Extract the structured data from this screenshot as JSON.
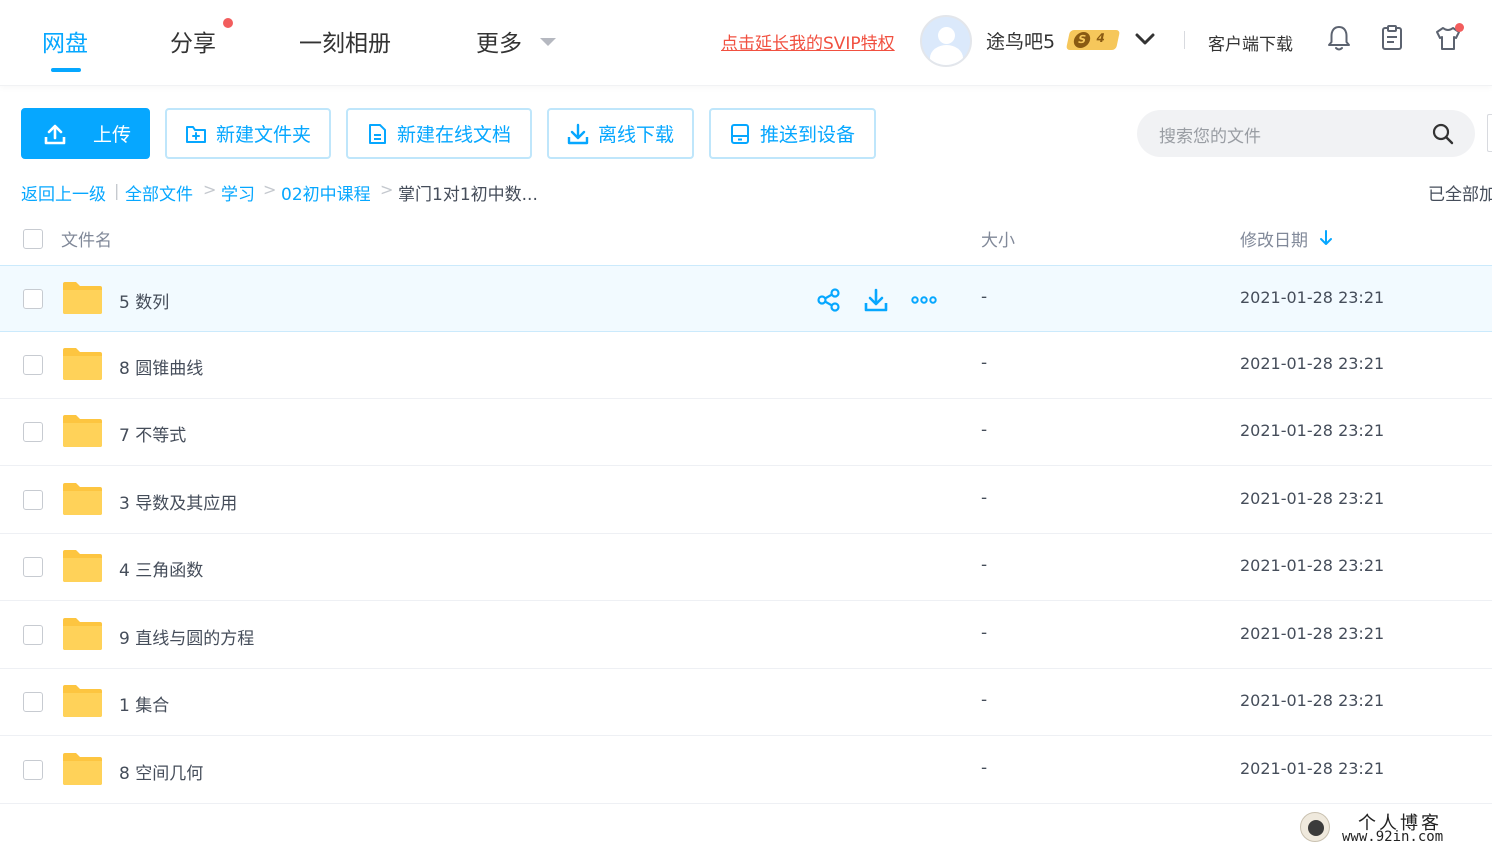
{
  "nav": {
    "tabs": [
      {
        "label": "网盘",
        "active": true
      },
      {
        "label": "分享",
        "badge_dot": true
      },
      {
        "label": "一刻相册"
      },
      {
        "label": "更多",
        "has_dropdown": true
      }
    ],
    "svip_promo": "点击延长我的SVIP特权",
    "user": {
      "name": "途鸟吧5",
      "vip_level": "4",
      "vip_letter": "S"
    },
    "client_download": "客户端下载",
    "icons": [
      "bell-icon",
      "clipboard-icon",
      "tshirt-icon"
    ]
  },
  "toolbar": {
    "upload": "上传",
    "new_folder": "新建文件夹",
    "new_doc": "新建在线文档",
    "offline_download": "离线下载",
    "push_to_device": "推送到设备",
    "search_placeholder": "搜索您的文件"
  },
  "breadcrumb": {
    "back": "返回上一级",
    "divider": "|",
    "path": [
      "全部文件",
      "学习",
      "02初中课程"
    ],
    "current": "掌门1对1初中数...",
    "sep": ">",
    "loaded_status": "已全部加"
  },
  "table": {
    "headers": {
      "name": "文件名",
      "size": "大小",
      "modified": "修改日期"
    },
    "sort": {
      "column": "modified",
      "direction": "desc"
    },
    "rows": [
      {
        "name": "5 数列",
        "size": "-",
        "modified": "2021-01-28 23:21",
        "hovered": true
      },
      {
        "name": "8 圆锥曲线",
        "size": "-",
        "modified": "2021-01-28 23:21"
      },
      {
        "name": "7 不等式",
        "size": "-",
        "modified": "2021-01-28 23:21"
      },
      {
        "name": "3 导数及其应用",
        "size": "-",
        "modified": "2021-01-28 23:21"
      },
      {
        "name": "4 三角函数",
        "size": "-",
        "modified": "2021-01-28 23:21"
      },
      {
        "name": "9 直线与圆的方程",
        "size": "-",
        "modified": "2021-01-28 23:21"
      },
      {
        "name": "1 集合",
        "size": "-",
        "modified": "2021-01-28 23:21"
      },
      {
        "name": "8 空间几何",
        "size": "-",
        "modified": "2021-01-28 23:21"
      }
    ],
    "row_actions": [
      "share-icon",
      "download-icon",
      "more-icon"
    ]
  },
  "watermark": {
    "line1": "个人博客",
    "line2": "www.92in.com"
  },
  "colors": {
    "accent": "#06a7ff",
    "promo": "#f15040",
    "folder": "#fdc540",
    "hover_row": "#f2faff"
  }
}
